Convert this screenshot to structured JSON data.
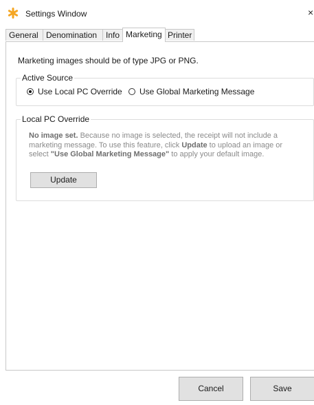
{
  "window": {
    "title": "Settings Window",
    "close_glyph": "×",
    "icon": "asterisk-icon",
    "accent_color": "#f5a623"
  },
  "tabs": [
    {
      "label": "General",
      "active": false
    },
    {
      "label": "Denomination",
      "active": false
    },
    {
      "label": "Info",
      "active": false
    },
    {
      "label": "Marketing",
      "active": true
    },
    {
      "label": "Printer",
      "active": false
    }
  ],
  "marketing": {
    "intro": "Marketing images should be of type JPG or PNG.",
    "active_source": {
      "legend": "Active Source",
      "options": [
        {
          "label": "Use Local PC Override",
          "checked": true
        },
        {
          "label": "Use Global Marketing Message",
          "checked": false
        }
      ]
    },
    "local_override": {
      "legend": "Local PC Override",
      "desc_bold1": "No image set.",
      "desc_text1": " Because no image is selected, the receipt will not include a marketing message. To use this feature, click ",
      "desc_bold2": "Update",
      "desc_text2": " to upload an image or select ",
      "desc_bold3": "\"Use Global Marketing Message\"",
      "desc_text3": " to apply your default image.",
      "update_label": "Update"
    }
  },
  "footer": {
    "cancel_label": "Cancel",
    "save_label": "Save"
  }
}
